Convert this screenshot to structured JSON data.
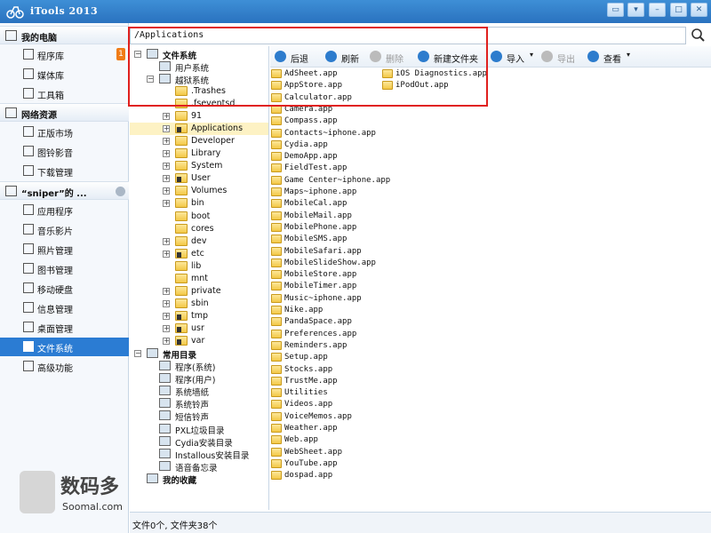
{
  "titlebar": {
    "title": "iTools 2013"
  },
  "sidebar": {
    "section_my_computer": "我的电脑",
    "section_network": "网络资源",
    "device_name": "“sniper”的 ...",
    "my_computer_items": [
      {
        "label": "程序库",
        "badge": "1"
      },
      {
        "label": "媒体库"
      },
      {
        "label": "工具箱"
      }
    ],
    "network_items": [
      {
        "label": "正版市场"
      },
      {
        "label": "图铃影音"
      },
      {
        "label": "下载管理"
      }
    ],
    "device_items": [
      {
        "label": "应用程序"
      },
      {
        "label": "音乐影片"
      },
      {
        "label": "照片管理"
      },
      {
        "label": "图书管理"
      },
      {
        "label": "移动硬盘"
      },
      {
        "label": "信息管理"
      },
      {
        "label": "桌面管理"
      },
      {
        "label": "文件系统",
        "active": true
      },
      {
        "label": "高级功能"
      }
    ]
  },
  "pathbar": {
    "value": "/Applications"
  },
  "tree": {
    "root_label": "文件系统",
    "user_system": "用户系统",
    "jailbreak_system": "越狱系统",
    "folders": [
      ".Trashes",
      ".fseventsd",
      "91",
      "Applications",
      "Developer",
      "Library",
      "System",
      "User",
      "Volumes",
      "bin",
      "boot",
      "cores",
      "dev",
      "etc",
      "lib",
      "mnt",
      "private",
      "sbin",
      "tmp",
      "usr",
      "var"
    ],
    "common_label": "常用目录",
    "common_items": [
      "程序(系统)",
      "程序(用户)",
      "系统墙纸",
      "系统铃声",
      "短信铃声",
      "PXL垃圾目录",
      "Cydia安装目录",
      "Installous安装目录",
      "语音备忘录"
    ],
    "favorites_label": "我的收藏"
  },
  "toolbar": {
    "back": "后退",
    "refresh": "刷新",
    "delete": "删除",
    "new_folder": "新建文件夹",
    "import": "导入",
    "export": "导出",
    "view": "查看"
  },
  "files": [
    "AdSheet.app",
    "AppStore.app",
    "Calculator.app",
    "Camera.app",
    "Compass.app",
    "Contacts~iphone.app",
    "Cydia.app",
    "DemoApp.app",
    "FieldTest.app",
    "Game Center~iphone.app",
    "Maps~iphone.app",
    "MobileCal.app",
    "MobileMail.app",
    "MobilePhone.app",
    "MobileSMS.app",
    "MobileSafari.app",
    "MobileSlideShow.app",
    "MobileStore.app",
    "MobileTimer.app",
    "Music~iphone.app",
    "Nike.app",
    "PandaSpace.app",
    "Preferences.app",
    "Reminders.app",
    "Setup.app",
    "Stocks.app",
    "TrustMe.app",
    "Utilities",
    "Videos.app",
    "VoiceMemos.app",
    "Weather.app",
    "Web.app",
    "WebSheet.app",
    "YouTube.app",
    "dospad.app"
  ],
  "files_col2": [
    "iOS Diagnostics.app",
    "iPodOut.app"
  ],
  "status": {
    "text": "文件0个, 文件夹38个"
  },
  "watermark": {
    "cn": "数码多",
    "en": "Soomal.com"
  },
  "colors": {
    "titlebar": "#2f7bc9",
    "active_item": "#2b7cd3",
    "annotation_box": "#e0201e",
    "badge": "#f07c17"
  }
}
